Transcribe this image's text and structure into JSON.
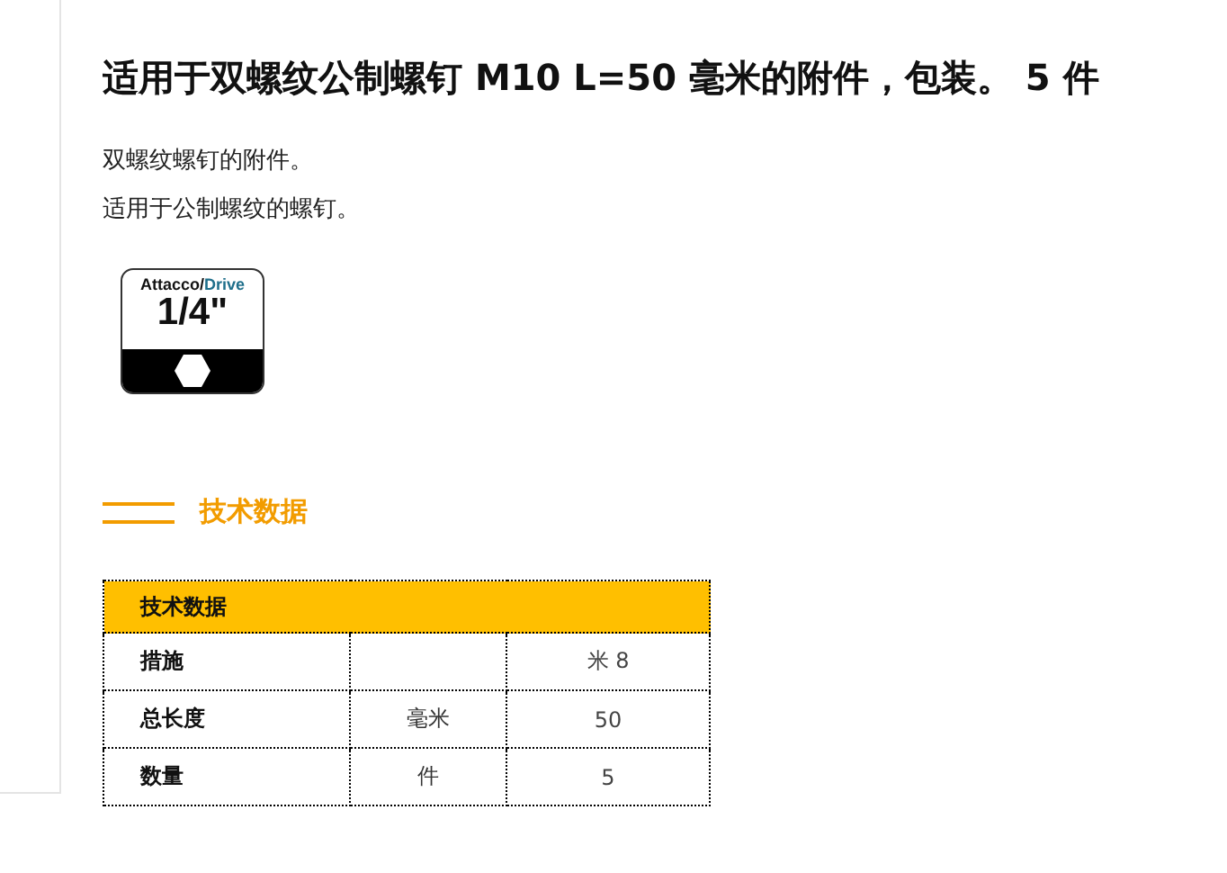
{
  "title": "适用于双螺纹公制螺钉 M10 L=50 毫米的附件，包装。 5 件",
  "description": [
    "双螺纹螺钉的附件。",
    "适用于公制螺纹的螺钉。"
  ],
  "drive_badge": {
    "label_start": "Attacco/",
    "label_accent": "Drive",
    "size": "1/4\""
  },
  "section_heading": "技术数据",
  "table": {
    "header": "技术数据",
    "rows": [
      {
        "name": "措施",
        "unit": "",
        "value": "米 8"
      },
      {
        "name": "总长度",
        "unit": "毫米",
        "value": "50"
      },
      {
        "name": "数量",
        "unit": "件",
        "value": "5"
      }
    ]
  }
}
